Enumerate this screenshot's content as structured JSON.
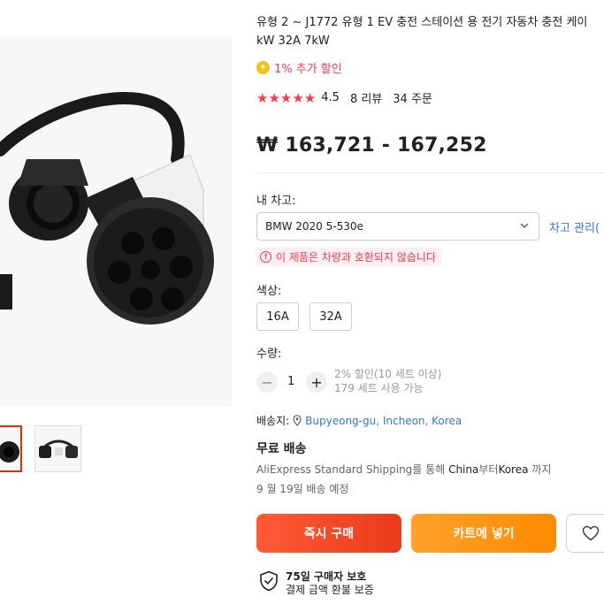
{
  "product": {
    "title_line1": "유형 2 ~ J1772 유형 1 EV 충전 스테이션 용 전기 자동차 충전 케이",
    "title_line2": "kW 32A 7kW",
    "promo": "1% 추가 할인",
    "promo_icon": "coin-icon",
    "rating": {
      "stars": 5,
      "score": "4.5",
      "reviews": "8 리뷰",
      "orders": "34 주문"
    },
    "price": "₩ 163,721 - 167,252"
  },
  "garage": {
    "label": "내 차고:",
    "selected_car": "BMW 2020 5-530e",
    "manage_link": "차고 관리(",
    "warning": "이 제품은 차량과 호환되지 않습니다"
  },
  "color": {
    "label": "색상:",
    "options": [
      "16A",
      "32A"
    ]
  },
  "quantity": {
    "label": "수량:",
    "value": "1",
    "discount_note": "2% 할인(10 세트 이상)",
    "stock_note": "179 세트 사용 가능"
  },
  "shipping": {
    "to_label": "배송지:",
    "location": "Bupyeong-gu, Incheon, Korea",
    "free": "무료 배송",
    "desc_prefix": "AliExpress Standard Shipping를 통해 ",
    "desc_from": "China",
    "desc_mid": "부터",
    "desc_to": "Korea",
    "desc_suffix": " 까지",
    "date": "9 월 19일 배송 예정"
  },
  "actions": {
    "buy_now": "즉시 구매",
    "add_to_cart": "카트에 넣기"
  },
  "protection": {
    "title": "75일 구매자 보호",
    "subtitle": "결제 금액 환불 보증"
  },
  "colors": {
    "accent_red": "#fd384f",
    "buy_button": "#ea3b1c",
    "cart_button": "#ff8a00",
    "link_blue": "#2e7ad9"
  }
}
